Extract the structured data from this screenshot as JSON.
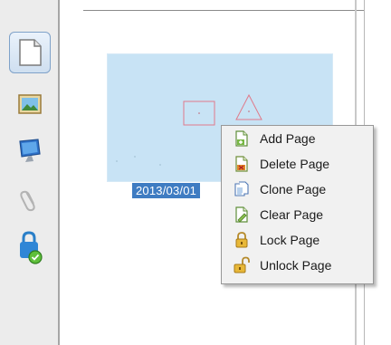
{
  "toolbar": {
    "items": [
      {
        "icon": "blank-page-icon",
        "active": true
      },
      {
        "icon": "image-icon",
        "active": false
      },
      {
        "icon": "monitor-icon",
        "active": false
      },
      {
        "icon": "paperclip-icon",
        "active": false
      },
      {
        "icon": "lock-check-icon",
        "active": false
      }
    ]
  },
  "page_list": {
    "thumbnail": {
      "date": "2013/03/01"
    }
  },
  "context_menu": {
    "items": [
      {
        "label": "Add Page",
        "icon": "add-page-icon"
      },
      {
        "label": "Delete Page",
        "icon": "delete-page-icon"
      },
      {
        "label": "Clone Page",
        "icon": "clone-page-icon"
      },
      {
        "label": "Clear Page",
        "icon": "clear-page-icon"
      },
      {
        "label": "Lock Page",
        "icon": "lock-page-icon"
      },
      {
        "label": "Unlock Page",
        "icon": "unlock-page-icon"
      }
    ]
  },
  "colors": {
    "selection": "#3f7cc2",
    "thumbnail_bg": "#c8e3f5",
    "menu_bg": "#f1f1f1"
  }
}
